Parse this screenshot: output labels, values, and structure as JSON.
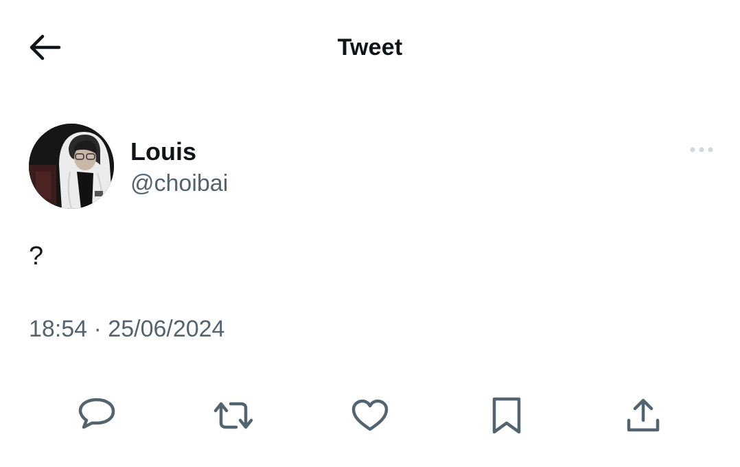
{
  "header": {
    "title": "Tweet",
    "back_icon": "arrow-left-icon"
  },
  "author": {
    "name": "Louis",
    "handle": "@choibai",
    "avatar": "avatar-photo",
    "more_icon": "more-horizontal-icon"
  },
  "tweet": {
    "text": "?",
    "timestamp": "18:54 · 25/06/2024"
  },
  "actions": [
    {
      "icon": "reply-icon"
    },
    {
      "icon": "retweet-icon"
    },
    {
      "icon": "like-heart-icon"
    },
    {
      "icon": "bookmark-icon"
    },
    {
      "icon": "share-icon"
    }
  ],
  "colors": {
    "text_primary": "#0f1419",
    "text_secondary": "#536471",
    "icon": "#536471",
    "more_dots": "#cfd9de",
    "background": "#ffffff"
  }
}
